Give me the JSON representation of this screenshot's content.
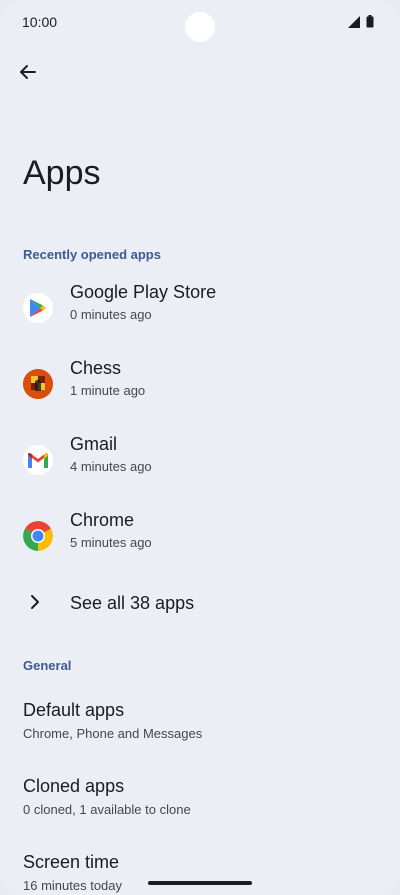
{
  "status": {
    "time": "10:00"
  },
  "title": "Apps",
  "recent": {
    "header": "Recently opened apps",
    "apps": [
      {
        "name": "Google Play Store",
        "sub": "0 minutes ago",
        "icon": "play-store-icon"
      },
      {
        "name": "Chess",
        "sub": "1 minute ago",
        "icon": "chess-icon"
      },
      {
        "name": "Gmail",
        "sub": "4 minutes ago",
        "icon": "gmail-icon"
      },
      {
        "name": "Chrome",
        "sub": "5 minutes ago",
        "icon": "chrome-icon"
      }
    ],
    "see_all": "See all 38 apps"
  },
  "general": {
    "header": "General",
    "items": [
      {
        "title": "Default apps",
        "sub": "Chrome, Phone and Messages"
      },
      {
        "title": "Cloned apps",
        "sub": "0 cloned, 1 available to clone"
      },
      {
        "title": "Screen time",
        "sub": "16 minutes today"
      }
    ]
  },
  "colors": {
    "background": "#eceef5",
    "accent": "#3c5a93"
  }
}
